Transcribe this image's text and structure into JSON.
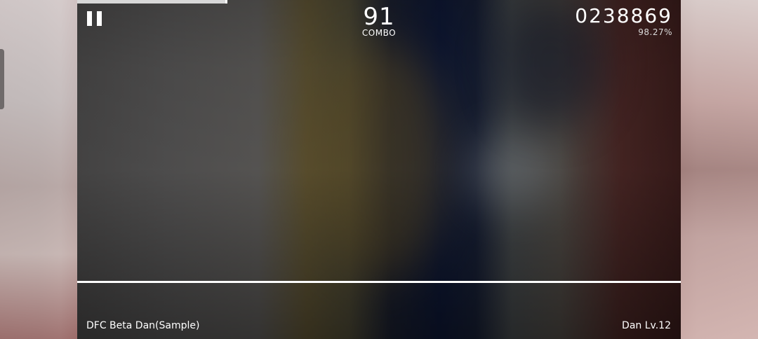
{
  "hud": {
    "combo_value": "91",
    "combo_label": "COMBO",
    "score": "0238869",
    "accuracy": "98.27%",
    "progress": 0.245
  },
  "song": {
    "title": "DFC Beta Dan(Sample)",
    "level": "Dan Lv.12"
  },
  "icons": {
    "pause": "pause-icon"
  },
  "colors": {
    "judge_line": "#ffffff",
    "text": "#ffffff"
  }
}
